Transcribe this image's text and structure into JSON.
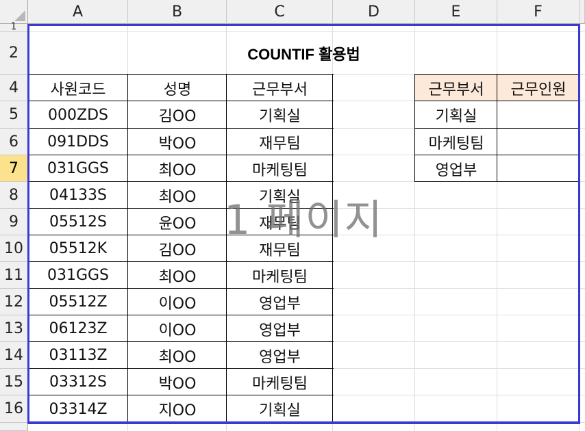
{
  "columns": [
    "A",
    "B",
    "C",
    "D",
    "E",
    "F"
  ],
  "rows": [
    "",
    "2",
    "4",
    "5",
    "6",
    "7",
    "8",
    "9",
    "10",
    "11",
    "12",
    "13",
    "14",
    "15",
    "16",
    ""
  ],
  "selected_row": "7",
  "title": "COUNTIF 활용법",
  "table": {
    "headers": [
      "사원코드",
      "성명",
      "근무부서"
    ],
    "rows": [
      [
        "000ZDS",
        "김OO",
        "기획실"
      ],
      [
        "091DDS",
        "박OO",
        "재무팀"
      ],
      [
        "031GGS",
        "최OO",
        "마케팅팀"
      ],
      [
        "04133S",
        "최OO",
        "기획실"
      ],
      [
        "05512S",
        "윤OO",
        "재무팀"
      ],
      [
        "05512K",
        "김OO",
        "재무팀"
      ],
      [
        "031GGS",
        "최OO",
        "마케팅팀"
      ],
      [
        "05512Z",
        "이OO",
        "영업부"
      ],
      [
        "06123Z",
        "이OO",
        "영업부"
      ],
      [
        "03113Z",
        "최OO",
        "영업부"
      ],
      [
        "03312S",
        "박OO",
        "마케팅팀"
      ],
      [
        "03314Z",
        "지OO",
        "기획실"
      ]
    ]
  },
  "summary": {
    "headers": [
      "근무부서",
      "근무인원"
    ],
    "rows": [
      [
        "기획실",
        ""
      ],
      [
        "마케팅팀",
        ""
      ],
      [
        "영업부",
        ""
      ]
    ],
    "header_fill": "#fde9d9"
  },
  "watermark": "1 페이지",
  "colors": {
    "page_break": "#3a3ad0",
    "selected_row_header": "#fce28c"
  }
}
